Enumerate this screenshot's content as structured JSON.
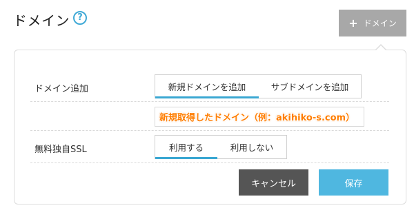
{
  "header": {
    "title": "ドメイン",
    "help_icon": "question-circle-icon",
    "help_symbol": "?",
    "add_button": {
      "icon": "plus-icon",
      "icon_symbol": "+",
      "label": "ドメイン"
    }
  },
  "form": {
    "add_domain": {
      "label": "ドメイン追加",
      "tabs": [
        {
          "label": "新規ドメインを追加",
          "active": true
        },
        {
          "label": "サブドメインを追加",
          "active": false
        }
      ]
    },
    "domain_input": {
      "value": "新規取得したドメイン（例：akihiko-s.com）"
    },
    "free_ssl": {
      "label": "無料独自SSL",
      "tabs": [
        {
          "label": "利用する",
          "active": true
        },
        {
          "label": "利用しない",
          "active": false
        }
      ]
    }
  },
  "actions": {
    "cancel_label": "キャンセル",
    "save_label": "保存"
  },
  "colors": {
    "accent": "#3aa7d2",
    "save_button": "#4fb7e0",
    "cancel_button": "#555555",
    "header_button": "#a8a8a8",
    "annotation_text": "#ff7d00"
  }
}
